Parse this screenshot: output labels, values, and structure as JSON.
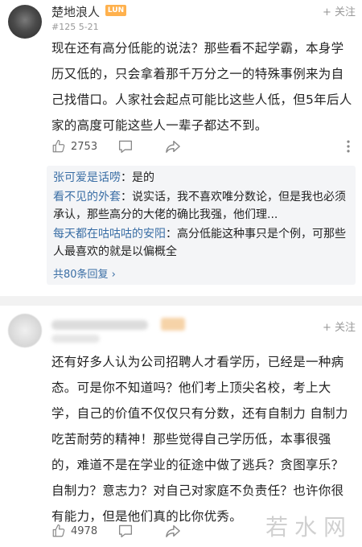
{
  "comments": [
    {
      "username": "楚地浪人",
      "level_badge": "LUN",
      "meta": "#125   5-21",
      "follow_label": "+ 关注",
      "body": "现在还有高分低能的说法？那些看不起学霸，本身学历又低的，只会拿着那千万分之一的特殊事例来为自己找借口。人家社会起点可能比这些人低，但5年后人家的高度可能这些人一辈子都达不到。",
      "like_count": "2753",
      "replies": [
        {
          "author": "张可爱是话唠",
          "text": "：是的"
        },
        {
          "author": "看不见的外套",
          "text": "：说实话，我不喜欢唯分数论，但是我也必须承认，那些高分的大佬的确比我强，他们理..."
        },
        {
          "author": "每天都在咕咕咕的安阳",
          "text": "：高分低能这种事只是个例，可那些人最喜欢的就是以偏概全"
        }
      ],
      "view_all": "共80条回复 ›"
    },
    {
      "follow_label": "+ 关注",
      "body": "还有好多人认为公司招聘人才看学历，已经是一种病态。可是你不知道吗？他们考上顶尖名校，考上大学，自己的价值不仅仅只有分数，还有自制力 自制力 吃苦耐劳的精神！那些觉得自己学历低，本事很强的，难道不是在学业的征途中做了逃兵？贪图享乐？自制力？意志力？对自己对家庭不负责任？也许你很有能力，但是他们真的比你优秀。",
      "like_count": "4978"
    }
  ],
  "watermark": "若水网",
  "colors": {
    "badge": "#ffb14d",
    "link": "#3a6ea5",
    "reply_bg": "#f4f5f7"
  },
  "icons": [
    "thumb-up-icon",
    "comment-icon",
    "share-icon",
    "more-icon"
  ]
}
